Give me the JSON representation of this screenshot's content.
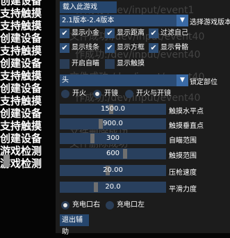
{
  "left_column": {
    "labels": [
      "创建设备",
      "支持触摸",
      "支持触摸",
      "创建设备",
      "支持触摸",
      "创建设备",
      "支持触摸",
      "创建设备",
      "支持触摸",
      "创建设备",
      "支持触摸",
      "创建设备",
      "游戏检测",
      "游戏检测"
    ]
  },
  "watermarks": [
    "作成功:/dev/input/event1",
    "文件成功:/dev/input/event40",
    "作成功:/dev/input/event40",
    "文件成功:/dev/input/event40",
    "作成功:/dev/input/event40",
    "文件删除成功",
    "文件删除成功",
    "文件删除成功"
  ],
  "panel": {
    "load_game_button": "载入此游戏",
    "version_select": {
      "value": "2.1版本-2.4版本",
      "label": "选择游戏版本"
    },
    "checkboxes": [
      {
        "label": "显示小金",
        "checked": true
      },
      {
        "label": "显示距离",
        "checked": true
      },
      {
        "label": "过滤自己",
        "checked": true
      },
      {
        "label": "显示线条",
        "checked": true
      },
      {
        "label": "显示方框",
        "checked": true
      },
      {
        "label": "显示骨骼",
        "checked": true
      },
      {
        "label": "开启自瞄",
        "checked": false
      },
      {
        "label": "显示触摸",
        "checked": false
      }
    ],
    "lock_part_select": {
      "value": "头",
      "label": "锁定部位"
    },
    "fire_mode": {
      "options": [
        "开火",
        "开镜",
        "开火与开镜"
      ],
      "selected": 1
    },
    "sliders": [
      {
        "value": "1500.0",
        "label": "触摸水平点",
        "fraction": 0.48
      },
      {
        "value": "900.0",
        "label": "触摸垂直点",
        "fraction": 0.38
      },
      {
        "value": "300",
        "label": "自瞄范围",
        "fraction": 0.3
      },
      {
        "value": "600",
        "label": "触摸范围",
        "fraction": 0.62
      },
      {
        "value": "20.00",
        "label": "压枪速度",
        "fraction": 0.45
      },
      {
        "value": "20.0",
        "label": "平滑力度",
        "fraction": 0.33
      }
    ],
    "charge_port": {
      "options": [
        "充电口右",
        "充电口左"
      ],
      "selected": 0
    },
    "exit_button": "退出辅助"
  }
}
